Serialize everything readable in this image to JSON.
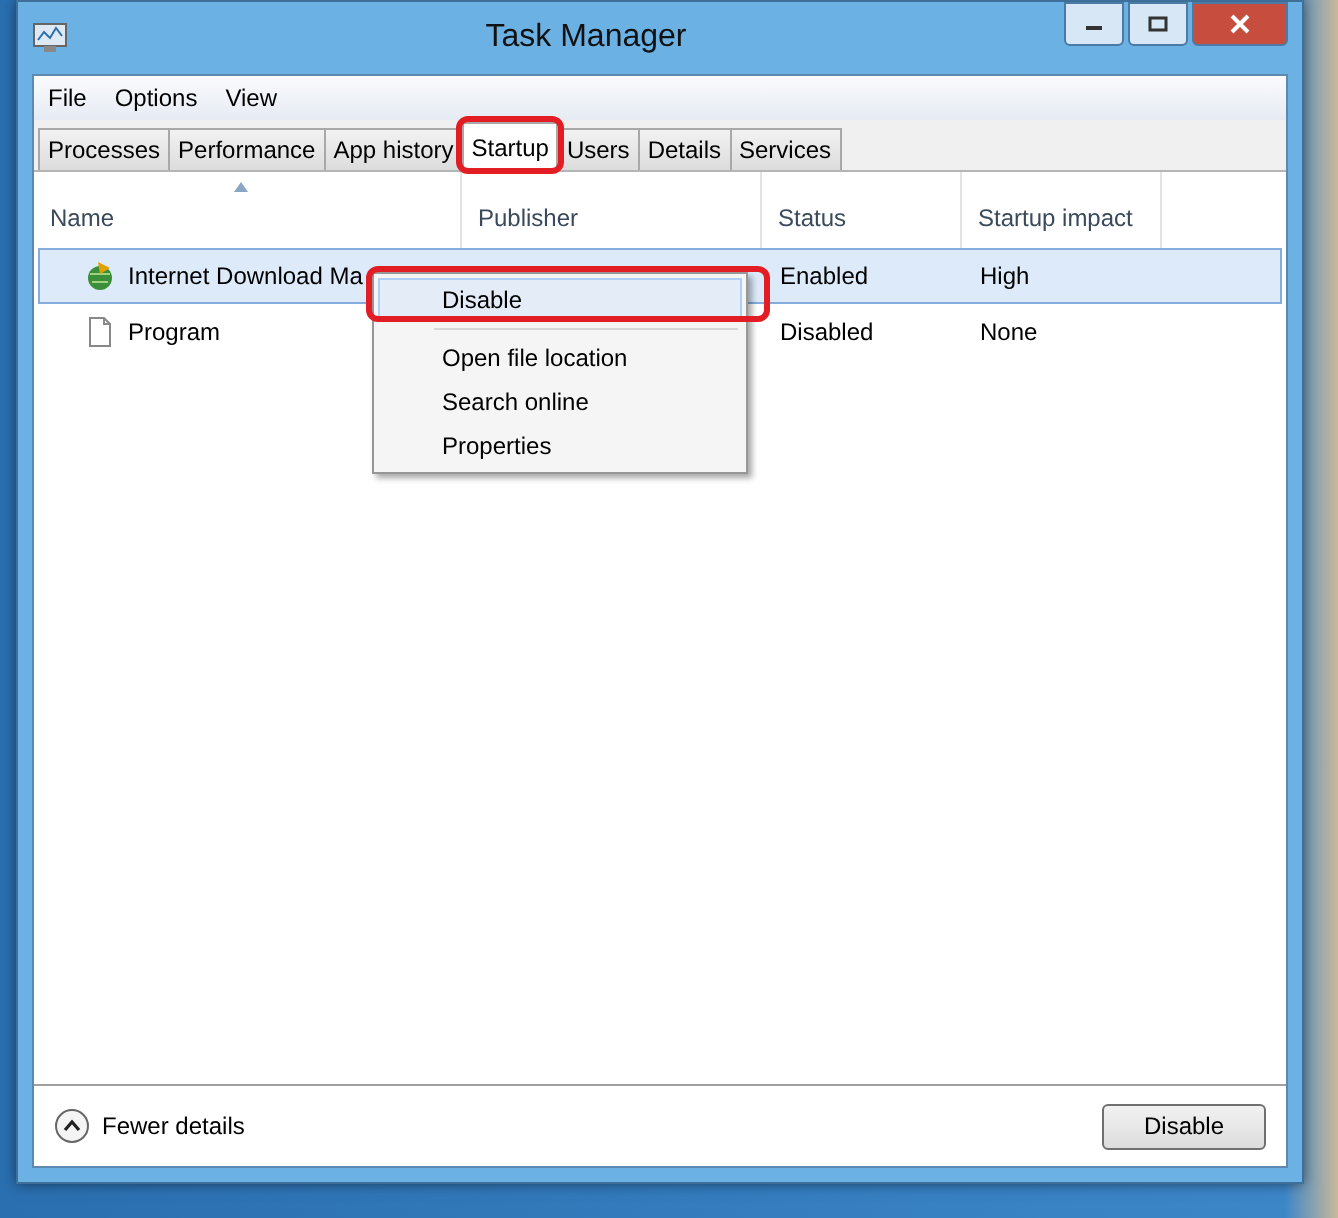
{
  "window": {
    "title": "Task Manager"
  },
  "menu_bar": [
    "File",
    "Options",
    "View"
  ],
  "tabs": [
    {
      "label": "Processes",
      "selected": false
    },
    {
      "label": "Performance",
      "selected": false
    },
    {
      "label": "App history",
      "selected": false
    },
    {
      "label": "Startup",
      "selected": true
    },
    {
      "label": "Users",
      "selected": false
    },
    {
      "label": "Details",
      "selected": false
    },
    {
      "label": "Services",
      "selected": false
    }
  ],
  "table": {
    "columns": [
      "Name",
      "Publisher",
      "Status",
      "Startup impact"
    ],
    "rows": [
      {
        "name": "Internet Download Ma",
        "status": "Enabled",
        "impact": "High",
        "kind": "app",
        "selected": true
      },
      {
        "name": "Program",
        "status": "Disabled",
        "impact": "None",
        "kind": "file",
        "selected": false
      }
    ]
  },
  "context_menu": {
    "items": [
      {
        "kind": "item",
        "label": "Disable",
        "selected": true
      },
      {
        "kind": "separator"
      },
      {
        "kind": "item",
        "label": "Open file location",
        "selected": false
      },
      {
        "kind": "item",
        "label": "Search online",
        "selected": false
      },
      {
        "kind": "item",
        "label": "Properties",
        "selected": false
      }
    ]
  },
  "footer": {
    "toggle_label": "Fewer details",
    "button": "Disable"
  }
}
